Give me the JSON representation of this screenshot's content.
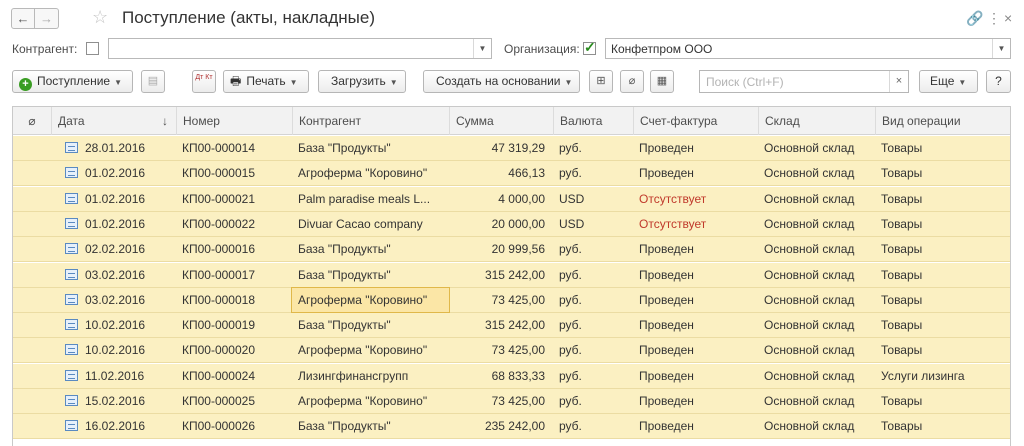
{
  "title": "Поступление (акты, накладные)",
  "window_icons": {
    "link": "🔗",
    "more": "⋮",
    "close": "×"
  },
  "filters": {
    "counterparty_label": "Контрагент:",
    "counterparty_checked": false,
    "counterparty_value": "",
    "org_label": "Организация:",
    "org_checked": true,
    "org_value": "Конфетпром ООО"
  },
  "toolbar": {
    "receipt_label": "Поступление",
    "print_label": "Печать",
    "load_label": "Загрузить",
    "create_based_label": "Создать на основании",
    "search_placeholder": "Поиск (Ctrl+F)",
    "more_label": "Еще",
    "help_label": "?",
    "dt_kt_label": "Дт Кт"
  },
  "columns": [
    "Дата",
    "Номер",
    "Контрагент",
    "Сумма",
    "Валюта",
    "Счет-фактура",
    "Склад",
    "Вид операции"
  ],
  "rows": [
    {
      "date": "28.01.2016",
      "number": "КП00-000014",
      "counterparty": "База \"Продукты\"",
      "sum": "47 319,29",
      "currency": "руб.",
      "invoice": "Проведен",
      "warehouse": "Основной склад",
      "operation": "Товары"
    },
    {
      "date": "01.02.2016",
      "number": "КП00-000015",
      "counterparty": "Агроферма \"Коровино\"",
      "sum": "466,13",
      "currency": "руб.",
      "invoice": "Проведен",
      "warehouse": "Основной склад",
      "operation": "Товары"
    },
    {
      "date": "01.02.2016",
      "number": "КП00-000021",
      "counterparty": "Palm paradise meals L...",
      "sum": "4 000,00",
      "currency": "USD",
      "invoice": "Отсутствует",
      "warehouse": "Основной склад",
      "operation": "Товары"
    },
    {
      "date": "01.02.2016",
      "number": "КП00-000022",
      "counterparty": "Divuar Cacao company",
      "sum": "20 000,00",
      "currency": "USD",
      "invoice": "Отсутствует",
      "warehouse": "Основной склад",
      "operation": "Товары"
    },
    {
      "date": "02.02.2016",
      "number": "КП00-000016",
      "counterparty": "База \"Продукты\"",
      "sum": "20 999,56",
      "currency": "руб.",
      "invoice": "Проведен",
      "warehouse": "Основной склад",
      "operation": "Товары"
    },
    {
      "date": "03.02.2016",
      "number": "КП00-000017",
      "counterparty": "База \"Продукты\"",
      "sum": "315 242,00",
      "currency": "руб.",
      "invoice": "Проведен",
      "warehouse": "Основной склад",
      "operation": "Товары"
    },
    {
      "date": "03.02.2016",
      "number": "КП00-000018",
      "counterparty": "Агроферма \"Коровино\"",
      "sum": "73 425,00",
      "currency": "руб.",
      "invoice": "Проведен",
      "warehouse": "Основной склад",
      "operation": "Товары"
    },
    {
      "date": "10.02.2016",
      "number": "КП00-000019",
      "counterparty": "База \"Продукты\"",
      "sum": "315 242,00",
      "currency": "руб.",
      "invoice": "Проведен",
      "warehouse": "Основной склад",
      "operation": "Товары"
    },
    {
      "date": "10.02.2016",
      "number": "КП00-000020",
      "counterparty": "Агроферма \"Коровино\"",
      "sum": "73 425,00",
      "currency": "руб.",
      "invoice": "Проведен",
      "warehouse": "Основной склад",
      "operation": "Товары"
    },
    {
      "date": "11.02.2016",
      "number": "КП00-000024",
      "counterparty": "Лизингфинансгрупп",
      "sum": "68 833,33",
      "currency": "руб.",
      "invoice": "Проведен",
      "warehouse": "Основной склад",
      "operation": "Услуги лизинга"
    },
    {
      "date": "15.02.2016",
      "number": "КП00-000025",
      "counterparty": "Агроферма \"Коровино\"",
      "sum": "73 425,00",
      "currency": "руб.",
      "invoice": "Проведен",
      "warehouse": "Основной склад",
      "operation": "Товары"
    },
    {
      "date": "16.02.2016",
      "number": "КП00-000026",
      "counterparty": "База \"Продукты\"",
      "sum": "235 242,00",
      "currency": "руб.",
      "invoice": "Проведен",
      "warehouse": "Основной склад",
      "operation": "Товары"
    }
  ],
  "selected_row": 6,
  "colors": {
    "row_bg": "#fbf0c2",
    "accent_green": "#3a9d23",
    "missing_red": "#c0392b"
  }
}
